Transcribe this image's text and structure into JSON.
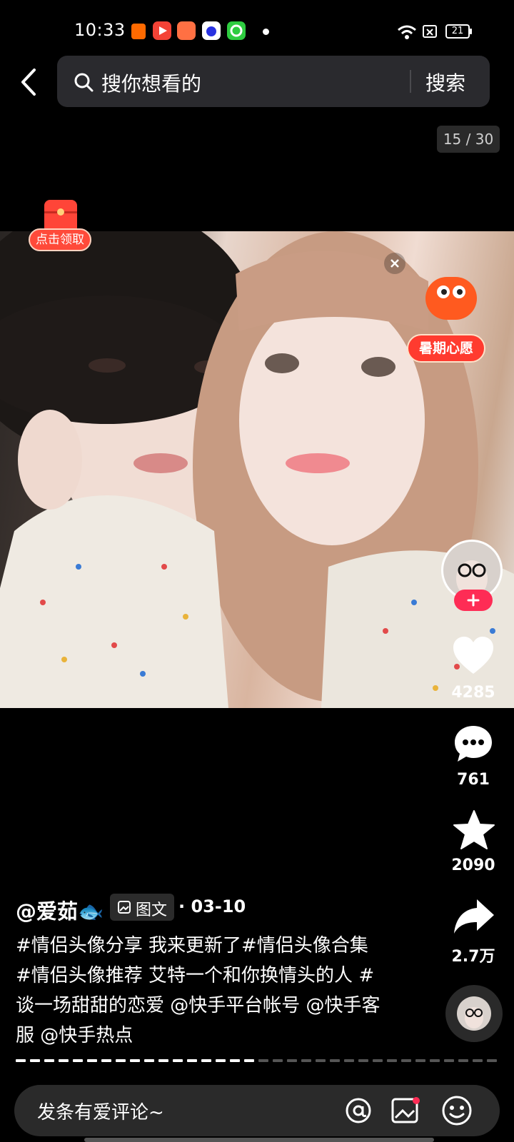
{
  "status_bar": {
    "time": "10:33",
    "battery": "21",
    "app_icons": [
      "taobao-icon",
      "video-app-icon",
      "game-app-icon",
      "baidu-icon",
      "green-app-icon"
    ]
  },
  "search": {
    "placeholder": "搜你想看的",
    "button_label": "搜索"
  },
  "pager": {
    "current": "15 / 30"
  },
  "promo": {
    "red_packet_label": "点击领取",
    "summer_wish_label": "暑期心愿"
  },
  "post": {
    "author": "@爱茹",
    "type_label": "图文",
    "date": "03-10",
    "caption": "#情侣头像分享 我来更新了#情侣头像合集 #情侣头像推荐 艾特一个和你换情头的人 #谈一场甜甜的恋爱 @快手平台帐号 @快手客服 @快手热点",
    "progress_fraction": 0.5
  },
  "actions": {
    "likes": "4285",
    "comments": "761",
    "favorites": "2090",
    "shares": "2.7万"
  },
  "comment_bar": {
    "placeholder": "发条有爱评论~"
  },
  "colors": {
    "accent": "#fe2c55",
    "bar": "#2a2a2e"
  }
}
